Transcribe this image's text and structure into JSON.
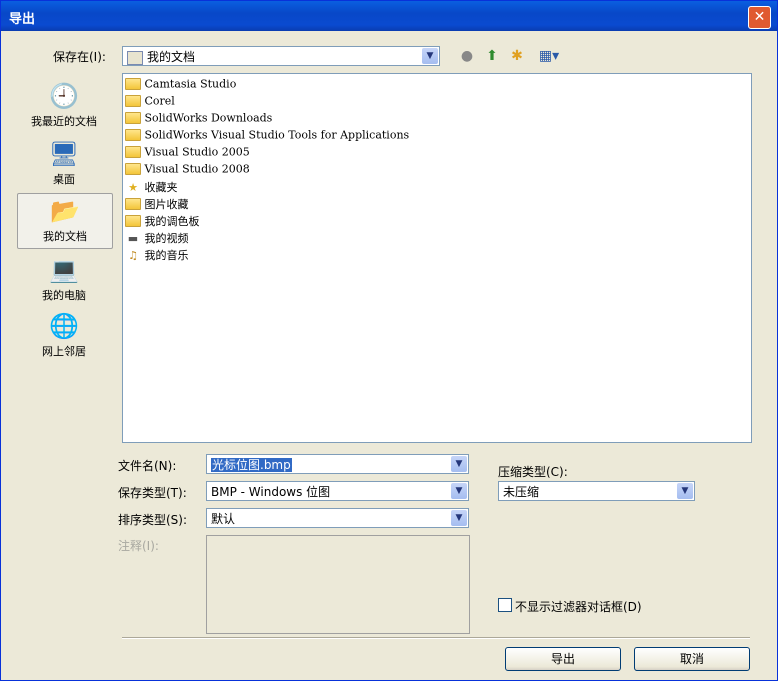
{
  "window": {
    "title": "导出",
    "close_glyph": "✕"
  },
  "location": {
    "label": "保存在(I):",
    "value": "我的文档"
  },
  "toolbar_icons": [
    "back-icon",
    "up-folder-icon",
    "new-folder-icon",
    "view-menu-icon"
  ],
  "places": [
    {
      "label": "我最近的文档",
      "icon": "recent-documents-icon"
    },
    {
      "label": "桌面",
      "icon": "desktop-icon"
    },
    {
      "label": "我的文档",
      "icon": "my-documents-icon",
      "active": true
    },
    {
      "label": "我的电脑",
      "icon": "my-computer-icon"
    },
    {
      "label": "网上邻居",
      "icon": "network-places-icon"
    }
  ],
  "files": [
    {
      "name": "Camtasia Studio",
      "icon": "folder-icon"
    },
    {
      "name": "Corel",
      "icon": "folder-icon"
    },
    {
      "name": "SolidWorks Downloads",
      "icon": "folder-icon"
    },
    {
      "name": "SolidWorks Visual Studio Tools for Applications",
      "icon": "folder-icon"
    },
    {
      "name": "Visual Studio 2005",
      "icon": "folder-icon"
    },
    {
      "name": "Visual Studio 2008",
      "icon": "folder-icon"
    },
    {
      "name": "收藏夹",
      "icon": "favorites-icon"
    },
    {
      "name": "图片收藏",
      "icon": "pictures-folder-icon"
    },
    {
      "name": "我的调色板",
      "icon": "palette-folder-icon"
    },
    {
      "name": "我的视频",
      "icon": "video-folder-icon"
    },
    {
      "name": "我的音乐",
      "icon": "music-folder-icon"
    }
  ],
  "form": {
    "filename": {
      "label": "文件名(N):",
      "value": "光标位图.bmp"
    },
    "filetype": {
      "label": "保存类型(T):",
      "value": "BMP - Windows 位图"
    },
    "sorttype": {
      "label": "排序类型(S):",
      "value": "默认"
    },
    "note": {
      "label": "注释(I):"
    },
    "compression": {
      "label": "压缩类型(C):",
      "value": "未压缩"
    },
    "checkbox": {
      "label": "不显示过滤器对话框(D)",
      "checked": false
    }
  },
  "buttons": {
    "export": "导出",
    "cancel": "取消"
  }
}
